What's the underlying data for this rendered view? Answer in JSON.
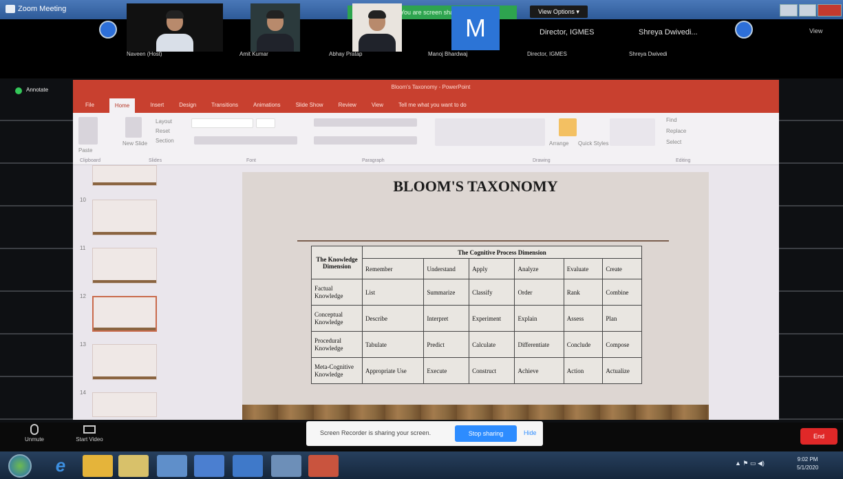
{
  "window": {
    "title": "Zoom Meeting",
    "share_banner": "You are screen sharing",
    "view_options": "View Options ▾",
    "view_button": "View"
  },
  "participants": [
    {
      "name": "Naveen (Host)"
    },
    {
      "name": "Amit Kumar"
    },
    {
      "name": "Abhay Pratap"
    },
    {
      "name": "Manoj Bhardwaj",
      "initial": "M"
    },
    {
      "name": "Director, IGMES"
    },
    {
      "name": "Shreya Dwivedi"
    }
  ],
  "name_only_labels": [
    "Director, IGMES",
    "Shreya Dwivedi..."
  ],
  "annotate_label": "Annotate",
  "powerpoint": {
    "title": "Bloom's Taxonomy - PowerPoint",
    "tabs": [
      "File",
      "Home",
      "Insert",
      "Design",
      "Transitions",
      "Animations",
      "Slide Show",
      "Review",
      "View",
      "Tell me what you want to do"
    ],
    "active_tab": "Home",
    "ribbon": {
      "paste": "Paste",
      "new_slide": "New Slide",
      "layout": "Layout",
      "reset": "Reset",
      "section": "Section",
      "arrange": "Arrange",
      "quick_styles": "Quick Styles",
      "find": "Find",
      "replace": "Replace",
      "select": "Select",
      "groups": [
        "Clipboard",
        "Slides",
        "Font",
        "Paragraph",
        "Drawing",
        "Editing"
      ]
    },
    "slide_numbers": [
      "10",
      "11",
      "12",
      "13",
      "14"
    ],
    "slide": {
      "title": "BLOOM'S TAXONOMY",
      "table": {
        "corner": "The Knowledge Dimension",
        "group_header": "The Cognitive Process Dimension",
        "columns": [
          "Remember",
          "Understand",
          "Apply",
          "Analyze",
          "Evaluate",
          "Create"
        ],
        "rows": [
          {
            "label": "Factual Knowledge",
            "cells": [
              "List",
              "Summarize",
              "Classify",
              "Order",
              "Rank",
              "Combine"
            ]
          },
          {
            "label": "Conceptual Knowledge",
            "cells": [
              "Describe",
              "Interpret",
              "Experiment",
              "Explain",
              "Assess",
              "Plan"
            ]
          },
          {
            "label": "Procedural Knowledge",
            "cells": [
              "Tabulate",
              "Predict",
              "Calculate",
              "Differentiate",
              "Conclude",
              "Compose"
            ]
          },
          {
            "label": "Meta-Cognitive Knowledge",
            "cells": [
              "Appropriate Use",
              "Execute",
              "Construct",
              "Achieve",
              "Action",
              "Actualize"
            ]
          }
        ]
      }
    }
  },
  "controls": {
    "unmute": "Unmute",
    "start_video": "Start Video",
    "notice_text": "Screen Recorder is sharing your screen.",
    "stop_sharing": "Stop sharing",
    "hide": "Hide",
    "end": "End"
  },
  "taskbar": {
    "time": "9:02 PM",
    "date": "5/1/2020"
  }
}
